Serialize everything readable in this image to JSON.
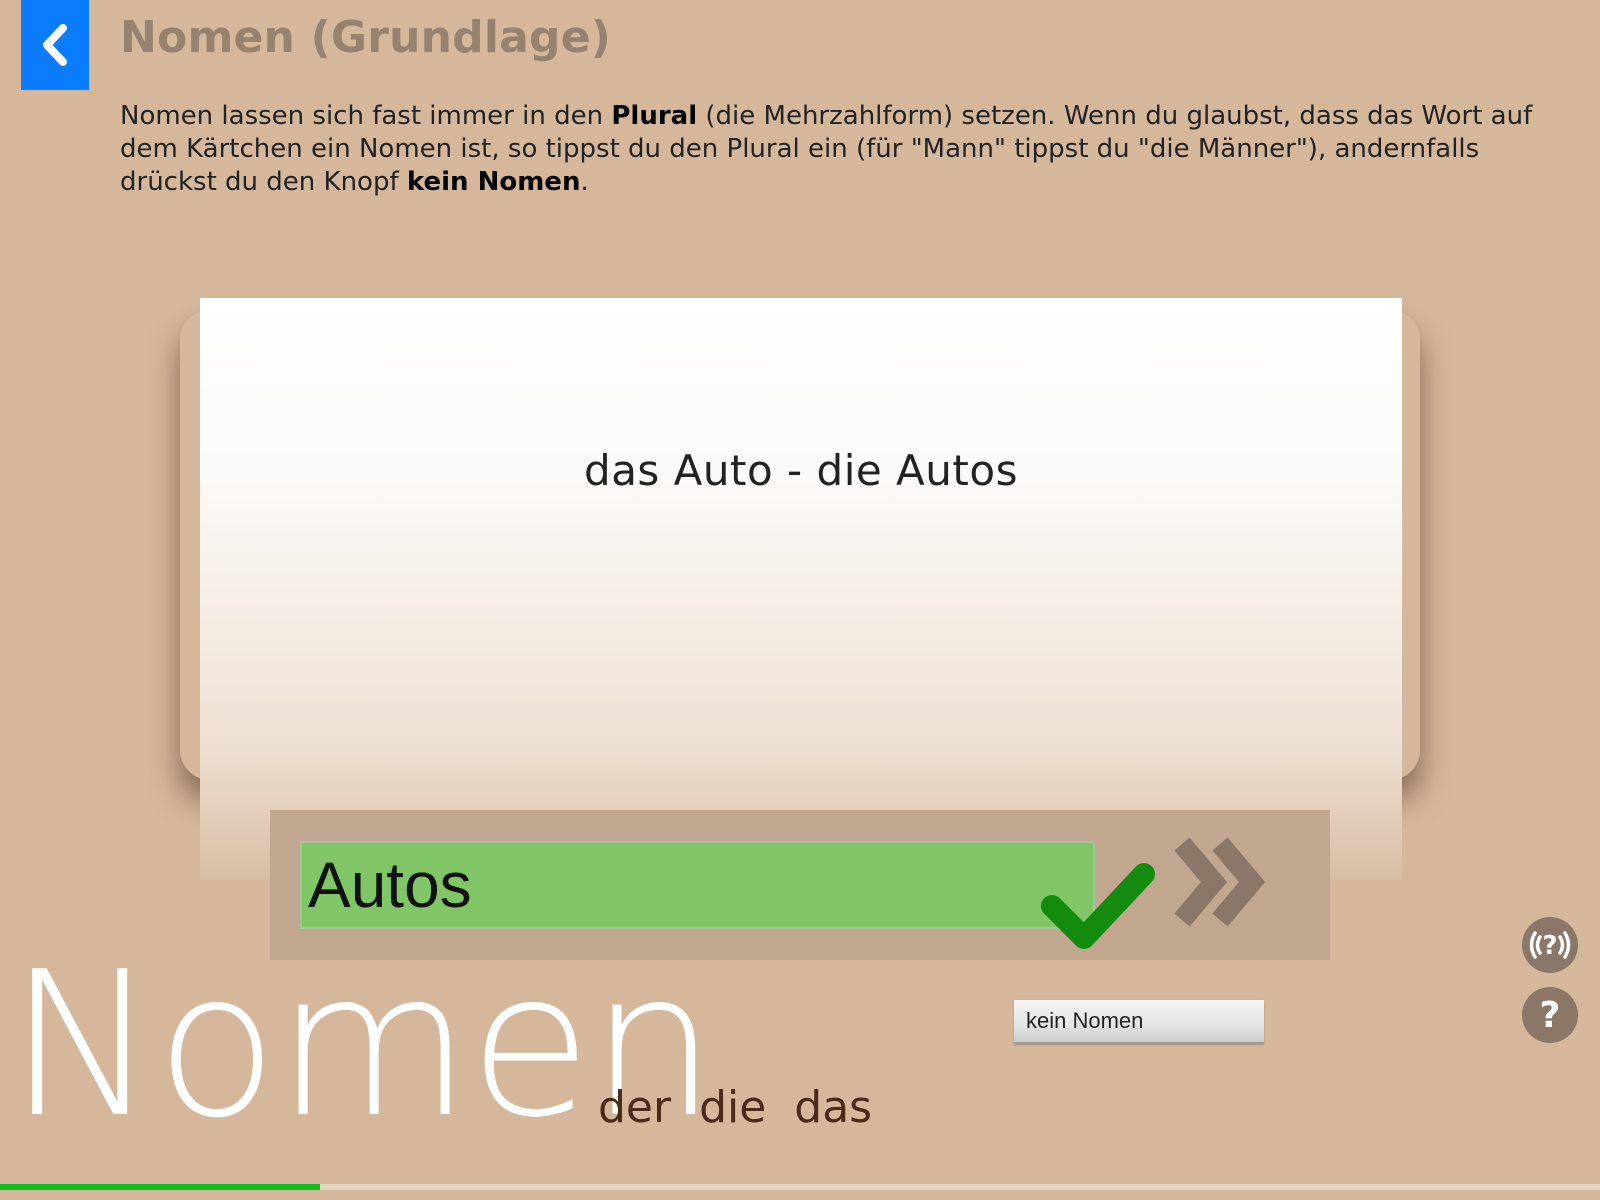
{
  "header": {
    "title": "Nomen (Grundlage)",
    "back_icon": "chevron-left-icon"
  },
  "instructions": {
    "part1": "Nomen lassen sich fast immer in den ",
    "plural": "Plural",
    "part2": " (die Mehrzahlform) setzen. Wenn du glaubst, dass das Wort auf dem Kärtchen ein Nomen ist, so tippst du den Plural ein (für \"Mann\" tippst du \"die Männer\"), andernfalls drückst du den Knopf ",
    "kein_nomen": "kein Nomen",
    "part3": "."
  },
  "card": {
    "word": "das Auto - die Autos"
  },
  "answer": {
    "value": "Autos",
    "correct": true,
    "check_color": "#138b0f",
    "input_color": "#80c566"
  },
  "buttons": {
    "kein_nomen": "kein Nomen"
  },
  "branding": {
    "big_word": "Nomen",
    "articles": "der die das"
  },
  "progress": {
    "fraction": 0.2,
    "color": "#11bb22"
  },
  "colors": {
    "background": "#d5b79b",
    "accent": "#0a7dff",
    "icon_gray": "#8a7767"
  }
}
